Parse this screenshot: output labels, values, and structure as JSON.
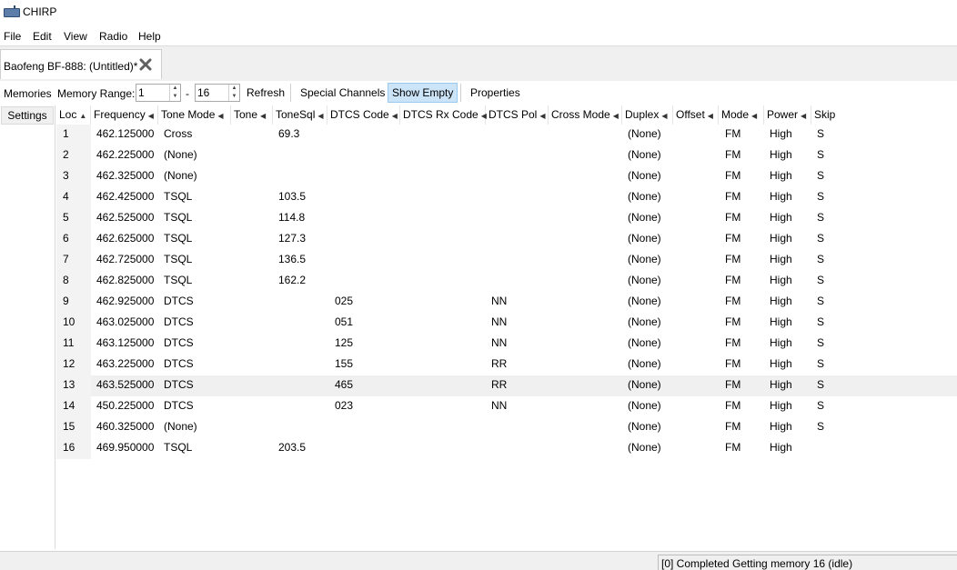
{
  "window": {
    "title": "CHIRP",
    "icon": "radio-icon"
  },
  "menu": [
    "File",
    "Edit",
    "View",
    "Radio",
    "Help"
  ],
  "tab": {
    "label": "Baofeng BF-888: (Untitled)*",
    "close_icon": "close-icon"
  },
  "toolbar": {
    "memories_label": "Memories",
    "memory_range_label": "Memory Range:",
    "range_start": "1",
    "range_sep": "-",
    "range_end": "16",
    "refresh": "Refresh",
    "special_channels": "Special Channels",
    "show_empty": "Show Empty",
    "properties": "Properties"
  },
  "left_tabs": {
    "settings": "Settings"
  },
  "columns": [
    "Loc",
    "Frequency",
    "Tone Mode",
    "Tone",
    "ToneSql",
    "DTCS Code",
    "DTCS Rx Code",
    "DTCS Pol",
    "Cross Mode",
    "Duplex",
    "Offset",
    "Mode",
    "Power",
    "Skip"
  ],
  "rows": [
    {
      "loc": "1",
      "frequency": "462.125000",
      "tone_mode": "Cross",
      "tone": "",
      "tonesql": "69.3",
      "dtcs_code": "",
      "dtcs_rx": "",
      "dtcs_pol": "",
      "cross_mode": "",
      "duplex": "(None)",
      "offset": "",
      "mode": "FM",
      "power": "High",
      "skip": "S"
    },
    {
      "loc": "2",
      "frequency": "462.225000",
      "tone_mode": "(None)",
      "tone": "",
      "tonesql": "",
      "dtcs_code": "",
      "dtcs_rx": "",
      "dtcs_pol": "",
      "cross_mode": "",
      "duplex": "(None)",
      "offset": "",
      "mode": "FM",
      "power": "High",
      "skip": "S"
    },
    {
      "loc": "3",
      "frequency": "462.325000",
      "tone_mode": "(None)",
      "tone": "",
      "tonesql": "",
      "dtcs_code": "",
      "dtcs_rx": "",
      "dtcs_pol": "",
      "cross_mode": "",
      "duplex": "(None)",
      "offset": "",
      "mode": "FM",
      "power": "High",
      "skip": "S"
    },
    {
      "loc": "4",
      "frequency": "462.425000",
      "tone_mode": "TSQL",
      "tone": "",
      "tonesql": "103.5",
      "dtcs_code": "",
      "dtcs_rx": "",
      "dtcs_pol": "",
      "cross_mode": "",
      "duplex": "(None)",
      "offset": "",
      "mode": "FM",
      "power": "High",
      "skip": "S"
    },
    {
      "loc": "5",
      "frequency": "462.525000",
      "tone_mode": "TSQL",
      "tone": "",
      "tonesql": "114.8",
      "dtcs_code": "",
      "dtcs_rx": "",
      "dtcs_pol": "",
      "cross_mode": "",
      "duplex": "(None)",
      "offset": "",
      "mode": "FM",
      "power": "High",
      "skip": "S"
    },
    {
      "loc": "6",
      "frequency": "462.625000",
      "tone_mode": "TSQL",
      "tone": "",
      "tonesql": "127.3",
      "dtcs_code": "",
      "dtcs_rx": "",
      "dtcs_pol": "",
      "cross_mode": "",
      "duplex": "(None)",
      "offset": "",
      "mode": "FM",
      "power": "High",
      "skip": "S"
    },
    {
      "loc": "7",
      "frequency": "462.725000",
      "tone_mode": "TSQL",
      "tone": "",
      "tonesql": "136.5",
      "dtcs_code": "",
      "dtcs_rx": "",
      "dtcs_pol": "",
      "cross_mode": "",
      "duplex": "(None)",
      "offset": "",
      "mode": "FM",
      "power": "High",
      "skip": "S"
    },
    {
      "loc": "8",
      "frequency": "462.825000",
      "tone_mode": "TSQL",
      "tone": "",
      "tonesql": "162.2",
      "dtcs_code": "",
      "dtcs_rx": "",
      "dtcs_pol": "",
      "cross_mode": "",
      "duplex": "(None)",
      "offset": "",
      "mode": "FM",
      "power": "High",
      "skip": "S"
    },
    {
      "loc": "9",
      "frequency": "462.925000",
      "tone_mode": "DTCS",
      "tone": "",
      "tonesql": "",
      "dtcs_code": "025",
      "dtcs_rx": "",
      "dtcs_pol": "NN",
      "cross_mode": "",
      "duplex": "(None)",
      "offset": "",
      "mode": "FM",
      "power": "High",
      "skip": "S"
    },
    {
      "loc": "10",
      "frequency": "463.025000",
      "tone_mode": "DTCS",
      "tone": "",
      "tonesql": "",
      "dtcs_code": "051",
      "dtcs_rx": "",
      "dtcs_pol": "NN",
      "cross_mode": "",
      "duplex": "(None)",
      "offset": "",
      "mode": "FM",
      "power": "High",
      "skip": "S"
    },
    {
      "loc": "11",
      "frequency": "463.125000",
      "tone_mode": "DTCS",
      "tone": "",
      "tonesql": "",
      "dtcs_code": "125",
      "dtcs_rx": "",
      "dtcs_pol": "NN",
      "cross_mode": "",
      "duplex": "(None)",
      "offset": "",
      "mode": "FM",
      "power": "High",
      "skip": "S"
    },
    {
      "loc": "12",
      "frequency": "463.225000",
      "tone_mode": "DTCS",
      "tone": "",
      "tonesql": "",
      "dtcs_code": "155",
      "dtcs_rx": "",
      "dtcs_pol": "RR",
      "cross_mode": "",
      "duplex": "(None)",
      "offset": "",
      "mode": "FM",
      "power": "High",
      "skip": "S"
    },
    {
      "loc": "13",
      "frequency": "463.525000",
      "tone_mode": "DTCS",
      "tone": "",
      "tonesql": "",
      "dtcs_code": "465",
      "dtcs_rx": "",
      "dtcs_pol": "RR",
      "cross_mode": "",
      "duplex": "(None)",
      "offset": "",
      "mode": "FM",
      "power": "High",
      "skip": "S",
      "selected": true
    },
    {
      "loc": "14",
      "frequency": "450.225000",
      "tone_mode": "DTCS",
      "tone": "",
      "tonesql": "",
      "dtcs_code": "023",
      "dtcs_rx": "",
      "dtcs_pol": "NN",
      "cross_mode": "",
      "duplex": "(None)",
      "offset": "",
      "mode": "FM",
      "power": "High",
      "skip": "S"
    },
    {
      "loc": "15",
      "frequency": "460.325000",
      "tone_mode": "(None)",
      "tone": "",
      "tonesql": "",
      "dtcs_code": "",
      "dtcs_rx": "",
      "dtcs_pol": "",
      "cross_mode": "",
      "duplex": "(None)",
      "offset": "",
      "mode": "FM",
      "power": "High",
      "skip": "S"
    },
    {
      "loc": "16",
      "frequency": "469.950000",
      "tone_mode": "TSQL",
      "tone": "",
      "tonesql": "203.5",
      "dtcs_code": "",
      "dtcs_rx": "",
      "dtcs_pol": "",
      "cross_mode": "",
      "duplex": "(None)",
      "offset": "",
      "mode": "FM",
      "power": "High",
      "skip": ""
    }
  ],
  "status": {
    "text": "[0] Completed Getting memory 16 (idle)"
  },
  "colors": {
    "selected_row": "#f0f0f0",
    "active_toggle": "#cce4f7",
    "chrome": "#f0f0f0"
  }
}
